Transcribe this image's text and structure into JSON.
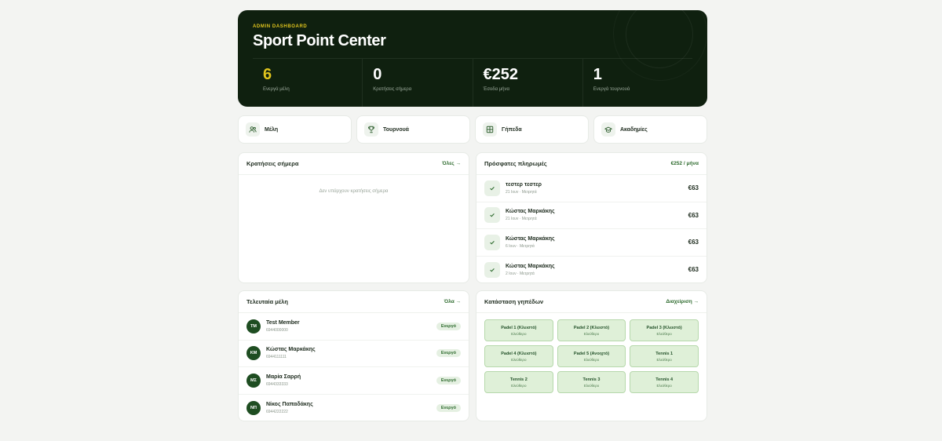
{
  "hero": {
    "kicker": "ADMIN DASHBOARD",
    "title": "Sport Point Center",
    "stats": [
      {
        "value": "6",
        "label": "Ενεργά μέλη"
      },
      {
        "value": "0",
        "label": "Κρατήσεις σήμερα"
      },
      {
        "value": "€252",
        "label": "Έσοδα μήνα"
      },
      {
        "value": "1",
        "label": "Ενεργά τουρνουά"
      }
    ]
  },
  "quick_links": [
    {
      "label": "Μέλη",
      "icon": "users-icon"
    },
    {
      "label": "Τουρνουά",
      "icon": "trophy-icon"
    },
    {
      "label": "Γήπεδα",
      "icon": "grid-icon"
    },
    {
      "label": "Ακαδημίες",
      "icon": "graduation-cap-icon"
    }
  ],
  "bookings": {
    "title": "Κρατήσεις σήμερα",
    "link": "Όλες →",
    "empty": "Δεν υπάρχουν κρατήσεις σήμερα"
  },
  "payments": {
    "title": "Πρόσφατες πληρωμές",
    "link": "€252 / μήνα",
    "items": [
      {
        "name": "τεστερ τεστερ",
        "sub": "21 Ιουν · Μετρητά",
        "amount": "€63"
      },
      {
        "name": "Κώστας Μαρκάκης",
        "sub": "21 Ιουν · Μετρητά",
        "amount": "€63"
      },
      {
        "name": "Κώστας Μαρκάκης",
        "sub": "6 Ιουν · Μετρητά",
        "amount": "€63"
      },
      {
        "name": "Κώστας Μαρκάκης",
        "sub": "2 Ιουν · Μετρητά",
        "amount": "€63"
      }
    ]
  },
  "members": {
    "title": "Τελευταία μέλη",
    "link": "Όλα →",
    "items": [
      {
        "initials": "TM",
        "name": "Test Member",
        "phone": "6944000000",
        "status": "Ενεργό"
      },
      {
        "initials": "ΚΜ",
        "name": "Κώστας Μαρκάκης",
        "phone": "6944111111",
        "status": "Ενεργό"
      },
      {
        "initials": "ΜΣ",
        "name": "Μαρία Σαρρή",
        "phone": "6944333333",
        "status": "Ενεργό"
      },
      {
        "initials": "ΝΠ",
        "name": "Νίκος Παπαδάκης",
        "phone": "6944222222",
        "status": "Ενεργό"
      }
    ]
  },
  "courts": {
    "title": "Κατάσταση γηπέδων",
    "link": "Διαχείριση →",
    "items": [
      {
        "name": "Padel 1 (Κλειστό)",
        "status": "Ελεύθερο"
      },
      {
        "name": "Padel 2 (Κλειστό)",
        "status": "Ελεύθερο"
      },
      {
        "name": "Padel 3 (Κλειστό)",
        "status": "Ελεύθερο"
      },
      {
        "name": "Padel 4 (Κλειστό)",
        "status": "Ελεύθερο"
      },
      {
        "name": "Padel 5 (Ανοιχτό)",
        "status": "Ελεύθερο"
      },
      {
        "name": "Tennis 1",
        "status": "Ελεύθερο"
      },
      {
        "name": "Tennis 2",
        "status": "Ελεύθερο"
      },
      {
        "name": "Tennis 3",
        "status": "Ελεύθερο"
      },
      {
        "name": "Tennis 4",
        "status": "Ελεύθερο"
      }
    ]
  },
  "colors": {
    "accent": "#e1c51d",
    "hero_bg": "#0f200f",
    "brand": "#1e4d21"
  }
}
